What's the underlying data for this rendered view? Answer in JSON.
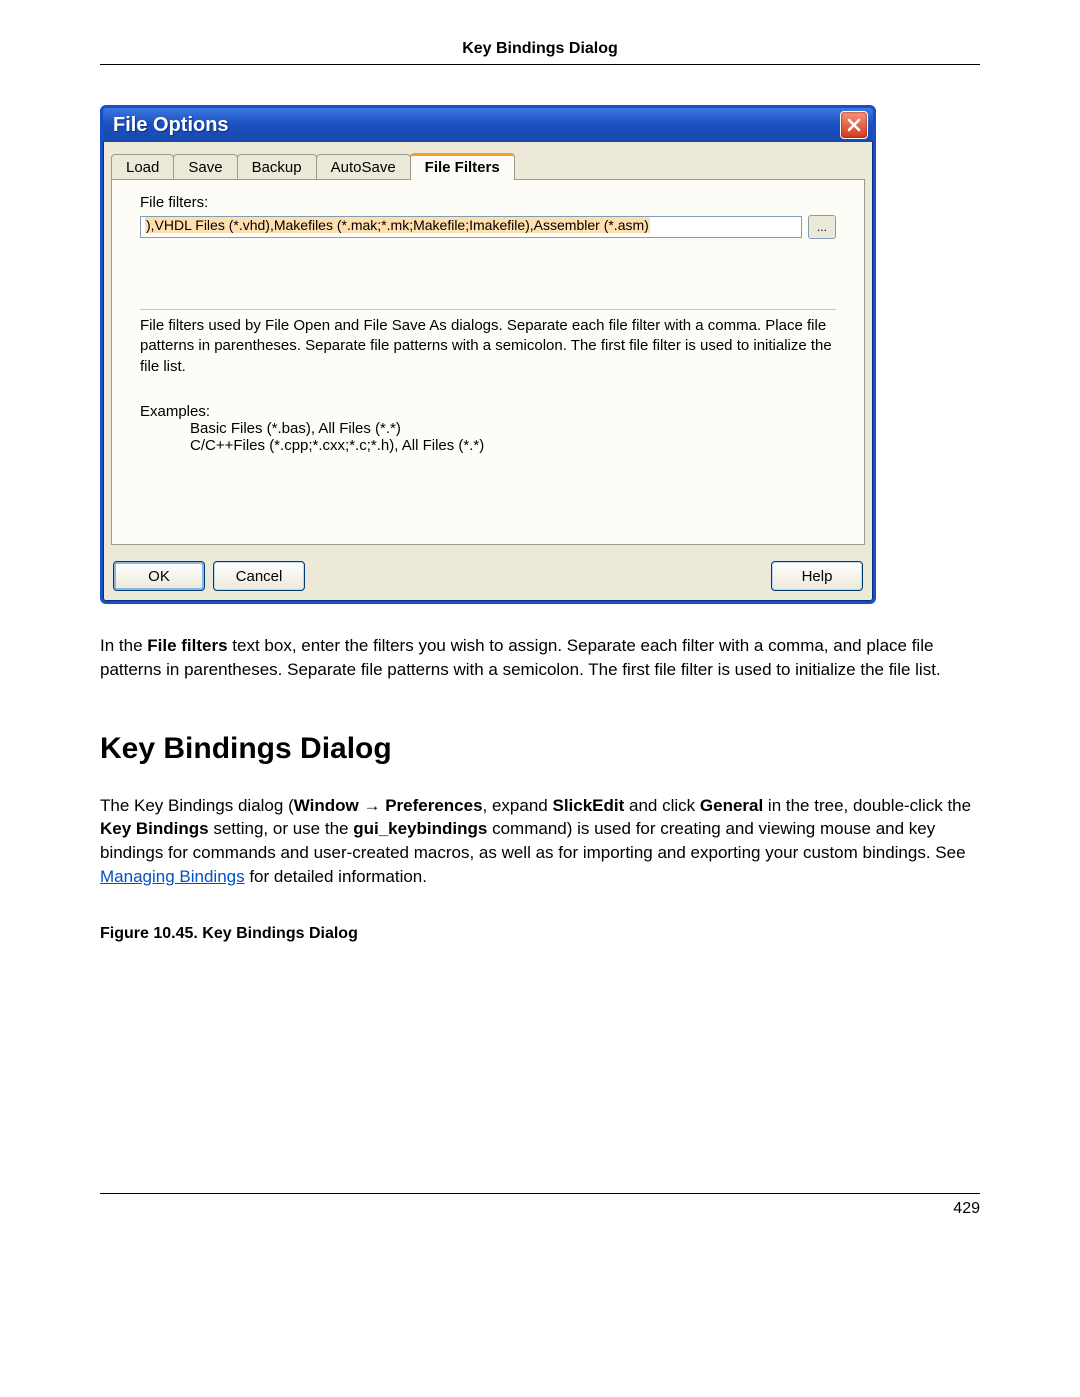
{
  "header": {
    "title": "Key Bindings Dialog"
  },
  "dialog": {
    "title": "File Options",
    "tabs": [
      {
        "label": "Load"
      },
      {
        "label": "Save"
      },
      {
        "label": "Backup"
      },
      {
        "label": "AutoSave"
      },
      {
        "label": "File Filters"
      }
    ],
    "active_tab_index": 4,
    "field_label": "File filters:",
    "field_value": "),VHDL Files (*.vhd),Makefiles (*.mak;*.mk;Makefile;Imakefile),Assembler (*.asm)",
    "browse_label": "...",
    "help_text": "File filters used by File Open and File Save As dialogs.   Separate each file filter with a comma.  Place file patterns in parentheses.  Separate file patterns with a semicolon.  The first file filter is used to initialize the file list.",
    "examples_label": "Examples:",
    "example_1": "Basic Files (*.bas), All Files (*.*)",
    "example_2": "C/C++Files (*.cpp;*.cxx;*.c;*.h), All Files (*.*)",
    "buttons": {
      "ok": "OK",
      "cancel": "Cancel",
      "help": "Help"
    }
  },
  "para1": {
    "pre": "In the ",
    "b1": "File filters",
    "post": " text box, enter the filters you wish to assign. Separate each filter with a comma, and place file patterns in parentheses. Separate file patterns with a semicolon. The first file filter is used to initialize the file list."
  },
  "section": {
    "heading": "Key Bindings Dialog"
  },
  "para2": {
    "t1": "The Key Bindings dialog (",
    "b1": "Window",
    "arrow": " → ",
    "b2": "Preferences",
    "t2": ", expand ",
    "b3": "SlickEdit",
    "t3": " and click ",
    "b4": "General",
    "t4": " in the tree, double-click the ",
    "b5": "Key Bindings",
    "t5": " setting, or use the ",
    "b6": "gui_keybindings",
    "t6": " command) is used for creating and viewing mouse and key bindings for commands and user-created macros, as well as for importing and exporting your custom bindings. See ",
    "link": "Managing Bindings",
    "t7": " for detailed information."
  },
  "figure_caption": "Figure 10.45.  Key Bindings Dialog",
  "footer": {
    "page": "429"
  }
}
